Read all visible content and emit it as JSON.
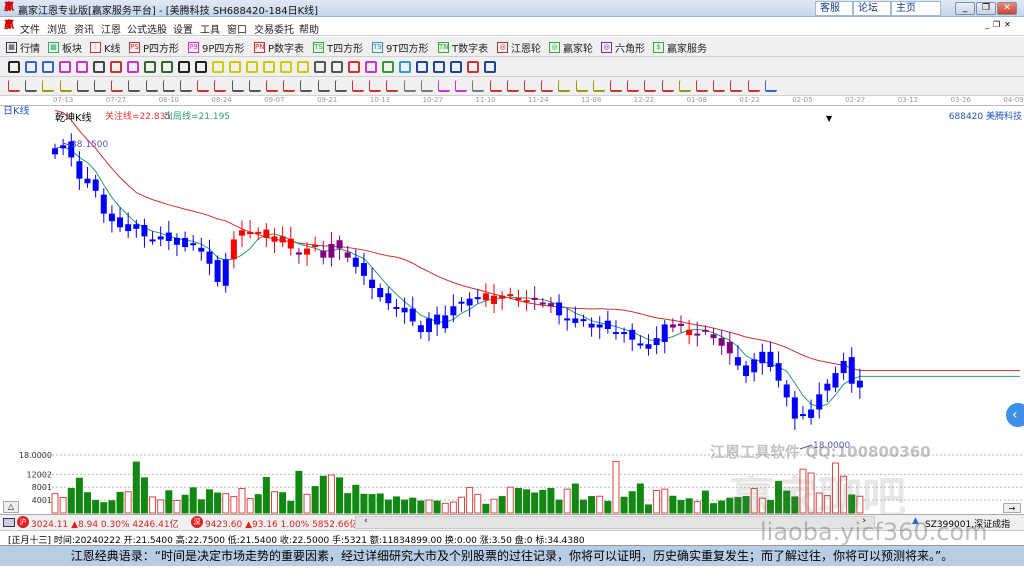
{
  "window": {
    "title": "赢家江恩专业版[赢家服务平台] - [美腾科技  SH688420-184日K线]",
    "links": [
      "客服",
      "论坛",
      "主页"
    ],
    "controls": [
      "_",
      "❐",
      "✕"
    ],
    "mdi_controls": [
      "_",
      "❐",
      "✕"
    ]
  },
  "menu": [
    "文件",
    "浏览",
    "资讯",
    "江恩",
    "公式选股",
    "设置",
    "工具",
    "窗口",
    "交易委托",
    "帮助"
  ],
  "toolbar1": [
    {
      "icon": "▦",
      "label": "行情",
      "color": "#334"
    },
    {
      "icon": "▩",
      "label": "板块",
      "color": "#3a6"
    },
    {
      "icon": "⫶",
      "label": "K线",
      "color": "#c33"
    },
    {
      "icon": "PS",
      "label": "P四方形",
      "color": "#c33"
    },
    {
      "icon": "P9",
      "label": "9P四方形",
      "color": "#c3c"
    },
    {
      "icon": "PN",
      "label": "P数字表",
      "color": "#c33"
    },
    {
      "icon": "TS",
      "label": "T四方形",
      "color": "#3a3"
    },
    {
      "icon": "T9",
      "label": "9T四方形",
      "color": "#39a"
    },
    {
      "icon": "TN",
      "label": "T数字表",
      "color": "#3a3"
    },
    {
      "icon": "◎",
      "label": "江恩轮",
      "color": "#a33"
    },
    {
      "icon": "◎",
      "label": "赢家轮",
      "color": "#3a3"
    },
    {
      "icon": "◎",
      "label": "六角形",
      "color": "#63a"
    },
    {
      "icon": "$",
      "label": "赢家服务",
      "color": "#3a3"
    }
  ],
  "toolbar2_colors": [
    "#222",
    "#36c",
    "#36c",
    "#c3c",
    "#c3c",
    "#444",
    "#c33",
    "#c3c",
    "#363",
    "#363",
    "#222",
    "#222",
    "#cc0",
    "#cc0",
    "#cc0",
    "#cc0",
    "#cc0",
    "#cc0",
    "#555",
    "#555",
    "#c33",
    "#c3c",
    "#393",
    "#39c",
    "#249",
    "#249",
    "#249",
    "#c33",
    "#249"
  ],
  "toolbar3_colors": [
    "#c33",
    "#555",
    "#990",
    "#990",
    "#555",
    "#555",
    "#c33",
    "#555",
    "#555",
    "#555",
    "#555",
    "#c33",
    "#c33",
    "#555",
    "#555",
    "#c33",
    "#c33",
    "#555",
    "#555",
    "#555",
    "#c33",
    "#c33",
    "#c33",
    "#777",
    "#777",
    "#c3c",
    "#c3c",
    "#777",
    "#c33",
    "#c33",
    "#c33",
    "#c33",
    "#990",
    "#990",
    "#990",
    "#c33",
    "#c33",
    "#c33",
    "#c33",
    "#990",
    "#c33",
    "#c33",
    "#c33",
    "#c33",
    "#36c"
  ],
  "chart": {
    "period_label": "日K线",
    "indicator": "乾坤K线",
    "focus_line": "关注线=22.835",
    "exit_line": "出局线=21.195",
    "stock": "688420 美腾科技",
    "high_label": "38.1500",
    "low_label": "18.0000",
    "dates": [
      "07-13",
      "07-27",
      "08-10",
      "08-24",
      "09-07",
      "09-21",
      "10-13",
      "10-27",
      "11-10",
      "11-24",
      "12-08",
      "12-22",
      "01-08",
      "01-22",
      "02-05",
      "02-27",
      "03-12",
      "03-26",
      "04-09"
    ],
    "vol_axis": [
      "18.0000",
      "12002",
      "8001",
      "4001"
    ],
    "watermark": "江恩工具软件 QQ:100800360",
    "watermark2": "赢家聊吧",
    "watermark3": "liaoba.yicf360.com",
    "colors": {
      "b": "#0000ff",
      "r": "#ff0000",
      "p": "#800080",
      "ma_focus": "#cc3333",
      "ma_exit": "#2a9a7a"
    }
  },
  "chart_data": {
    "type": "candlestick",
    "price_range": [
      17.5,
      39.5
    ],
    "closes": [
      37.8,
      38.0,
      37.2,
      35.8,
      35.5,
      35.0,
      33.5,
      33.0,
      32.6,
      32.8,
      32.5,
      32.0,
      31.8,
      32.0,
      31.7,
      31.9,
      31.3,
      31.5,
      31.0,
      30.2,
      29.0,
      30.5,
      31.8,
      32.4,
      32.3,
      32.2,
      31.9,
      32.0,
      31.6,
      31.2,
      30.8,
      31.2,
      31.3,
      30.6,
      31.5,
      31.2,
      30.6,
      30.0,
      29.4,
      28.6,
      28.0,
      27.6,
      27.3,
      27.0,
      26.4,
      25.7,
      26.6,
      26.2,
      26.8,
      27.4,
      27.7,
      27.9,
      28.0,
      27.8,
      28.1,
      27.9,
      28.2,
      27.8,
      27.7,
      27.9,
      27.6,
      27.4,
      26.8,
      26.6,
      26.3,
      26.5,
      26.0,
      26.2,
      25.9,
      25.7,
      25.6,
      25.2,
      24.9,
      24.6,
      25.3,
      26.2,
      26.0,
      26.1,
      25.5,
      25.6,
      25.8,
      25.3,
      24.8,
      24.3,
      23.5,
      22.8,
      23.9,
      24.4,
      23.4,
      22.5,
      21.4,
      20.0,
      20.3,
      20.6,
      21.6,
      22.3,
      23.0,
      23.8,
      22.3,
      22.5
    ],
    "state": "bbbbbbbbbbbbbbbbbbbbbbrrrrrrrrprrppppbbbbbbbbbbbbbbbbrrrrrrpppbbbbbbbbbbbbbbpprpppppbbbbbbbbbbbbbbbbrpr",
    "volumes": [
      6000,
      4800,
      7600,
      10800,
      6300,
      3900,
      3200,
      3800,
      6400,
      6600,
      15800,
      10900,
      5000,
      4100,
      6900,
      3900,
      5500,
      7800,
      4100,
      7200,
      6200,
      6000,
      5100,
      7600,
      4500,
      5700,
      11000,
      6600,
      6300,
      3600,
      12900,
      5800,
      8200,
      11400,
      11800,
      10900,
      6000,
      8600,
      5800,
      5700,
      5900,
      4000,
      5000,
      4000,
      4600,
      3700,
      4000,
      3700,
      3000,
      3400,
      4900,
      7900,
      5800,
      2700,
      4300,
      5100,
      8000,
      7600,
      7200,
      6200,
      7000,
      7600,
      4000,
      7400,
      9000,
      4000,
      5100,
      5200,
      3600,
      16000,
      4900,
      6600,
      9000,
      2500,
      7000,
      7400,
      5200,
      3900,
      4400,
      3600,
      6800,
      2900,
      3700,
      4600,
      4800,
      5100,
      7600,
      4600,
      3900,
      9800,
      6800,
      5000,
      13600,
      12400,
      6200,
      5400,
      15500,
      11400,
      5600,
      5200
    ],
    "vol_range": [
      0,
      18000
    ]
  },
  "status": {
    "sh_index": "3024.11 ▲8.94 0.30% 4246.41亿",
    "sz_index": "9423.60 ▲93.16 1.00% 5852.66亿",
    "right_index": "SZ399001,深证成指",
    "info": "[正月十三] 时间:20240222 开:21.5400 高:22.7500 低:21.5400 收:22.5000 手:5321 额:11834899.00 换:0.00 涨:3.50 盘:0 标:34.4380"
  },
  "quote": "江恩经典语录：“时间是决定市场走势的重要因素，经过详细研究大市及个别股票的过往记录，你将可以证明，历史确实重复发生；而了解过往，你将可以预测将来。”。"
}
